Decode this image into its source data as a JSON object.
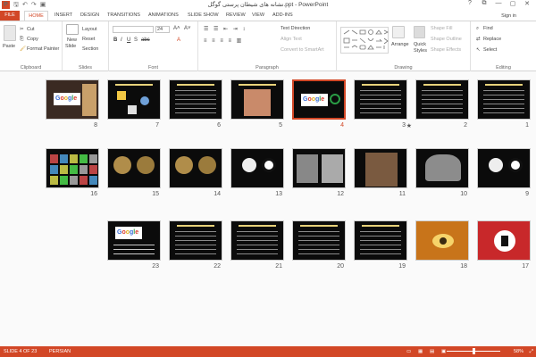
{
  "window": {
    "title": "نشانه های شیطان پرستی گوگل.ppt - PowerPoint",
    "qat": [
      "save-icon",
      "undo-icon",
      "redo-icon",
      "present-icon"
    ],
    "controls": [
      "?",
      "⧉",
      "—",
      "▢",
      "✕"
    ]
  },
  "ribbon": {
    "tabs": [
      "FILE",
      "HOME",
      "INSERT",
      "DESIGN",
      "TRANSITIONS",
      "ANIMATIONS",
      "SLIDE SHOW",
      "REVIEW",
      "VIEW",
      "ADD-INS"
    ],
    "active_tab": "HOME",
    "sign_in": "Sign in",
    "clipboard": {
      "paste": "Paste",
      "cut": "Cut",
      "copy": "Copy",
      "format_painter": "Format Painter",
      "label": "Clipboard"
    },
    "slides": {
      "new_slide": "New",
      "new_slide_2": "Slide",
      "layout": "Layout",
      "reset": "Reset",
      "section": "Section",
      "label": "Slides"
    },
    "font": {
      "size": "24",
      "label": "Font"
    },
    "paragraph": {
      "text_direction": "Text Direction",
      "align_text": "Align Text",
      "convert_smartart": "Convert to SmartArt",
      "label": "Paragraph"
    },
    "drawing": {
      "arrange": "Arrange",
      "quick_styles": "Quick",
      "quick_styles_2": "Styles",
      "shape_fill": "Shape Fill",
      "shape_outline": "Shape Outline",
      "shape_effects": "Shape Effects",
      "label": "Drawing"
    },
    "editing": {
      "find": "Find",
      "replace": "Replace",
      "select": "Select",
      "label": "Editing"
    }
  },
  "slides": [
    {
      "n": "1",
      "theme": "dark-text"
    },
    {
      "n": "2",
      "theme": "dark-text",
      "marker": "★"
    },
    {
      "n": "3",
      "theme": "dark-text"
    },
    {
      "n": "4",
      "theme": "google",
      "selected": true
    },
    {
      "n": "5",
      "theme": "figure"
    },
    {
      "n": "6",
      "theme": "dark-text"
    },
    {
      "n": "7",
      "theme": "symbols"
    },
    {
      "n": "8",
      "theme": "google-photo"
    },
    {
      "n": "9",
      "theme": "cross"
    },
    {
      "n": "10",
      "theme": "eagle"
    },
    {
      "n": "11",
      "theme": "statue"
    },
    {
      "n": "12",
      "theme": "photos"
    },
    {
      "n": "13",
      "theme": "cross"
    },
    {
      "n": "14",
      "theme": "coins"
    },
    {
      "n": "15",
      "theme": "coins"
    },
    {
      "n": "16",
      "theme": "grid"
    },
    {
      "n": "17",
      "theme": "flag"
    },
    {
      "n": "18",
      "theme": "eye"
    },
    {
      "n": "19",
      "theme": "dark-text"
    },
    {
      "n": "20",
      "theme": "dark-text"
    },
    {
      "n": "21",
      "theme": "dark-text"
    },
    {
      "n": "22",
      "theme": "dark-text"
    },
    {
      "n": "23",
      "theme": "google-text"
    }
  ],
  "status": {
    "slide": "SLIDE 4 OF 23",
    "language": "PERSIAN",
    "zoom": "58%"
  },
  "colors": {
    "accent": "#d24726",
    "slide_bg": "#0b0b0b"
  }
}
